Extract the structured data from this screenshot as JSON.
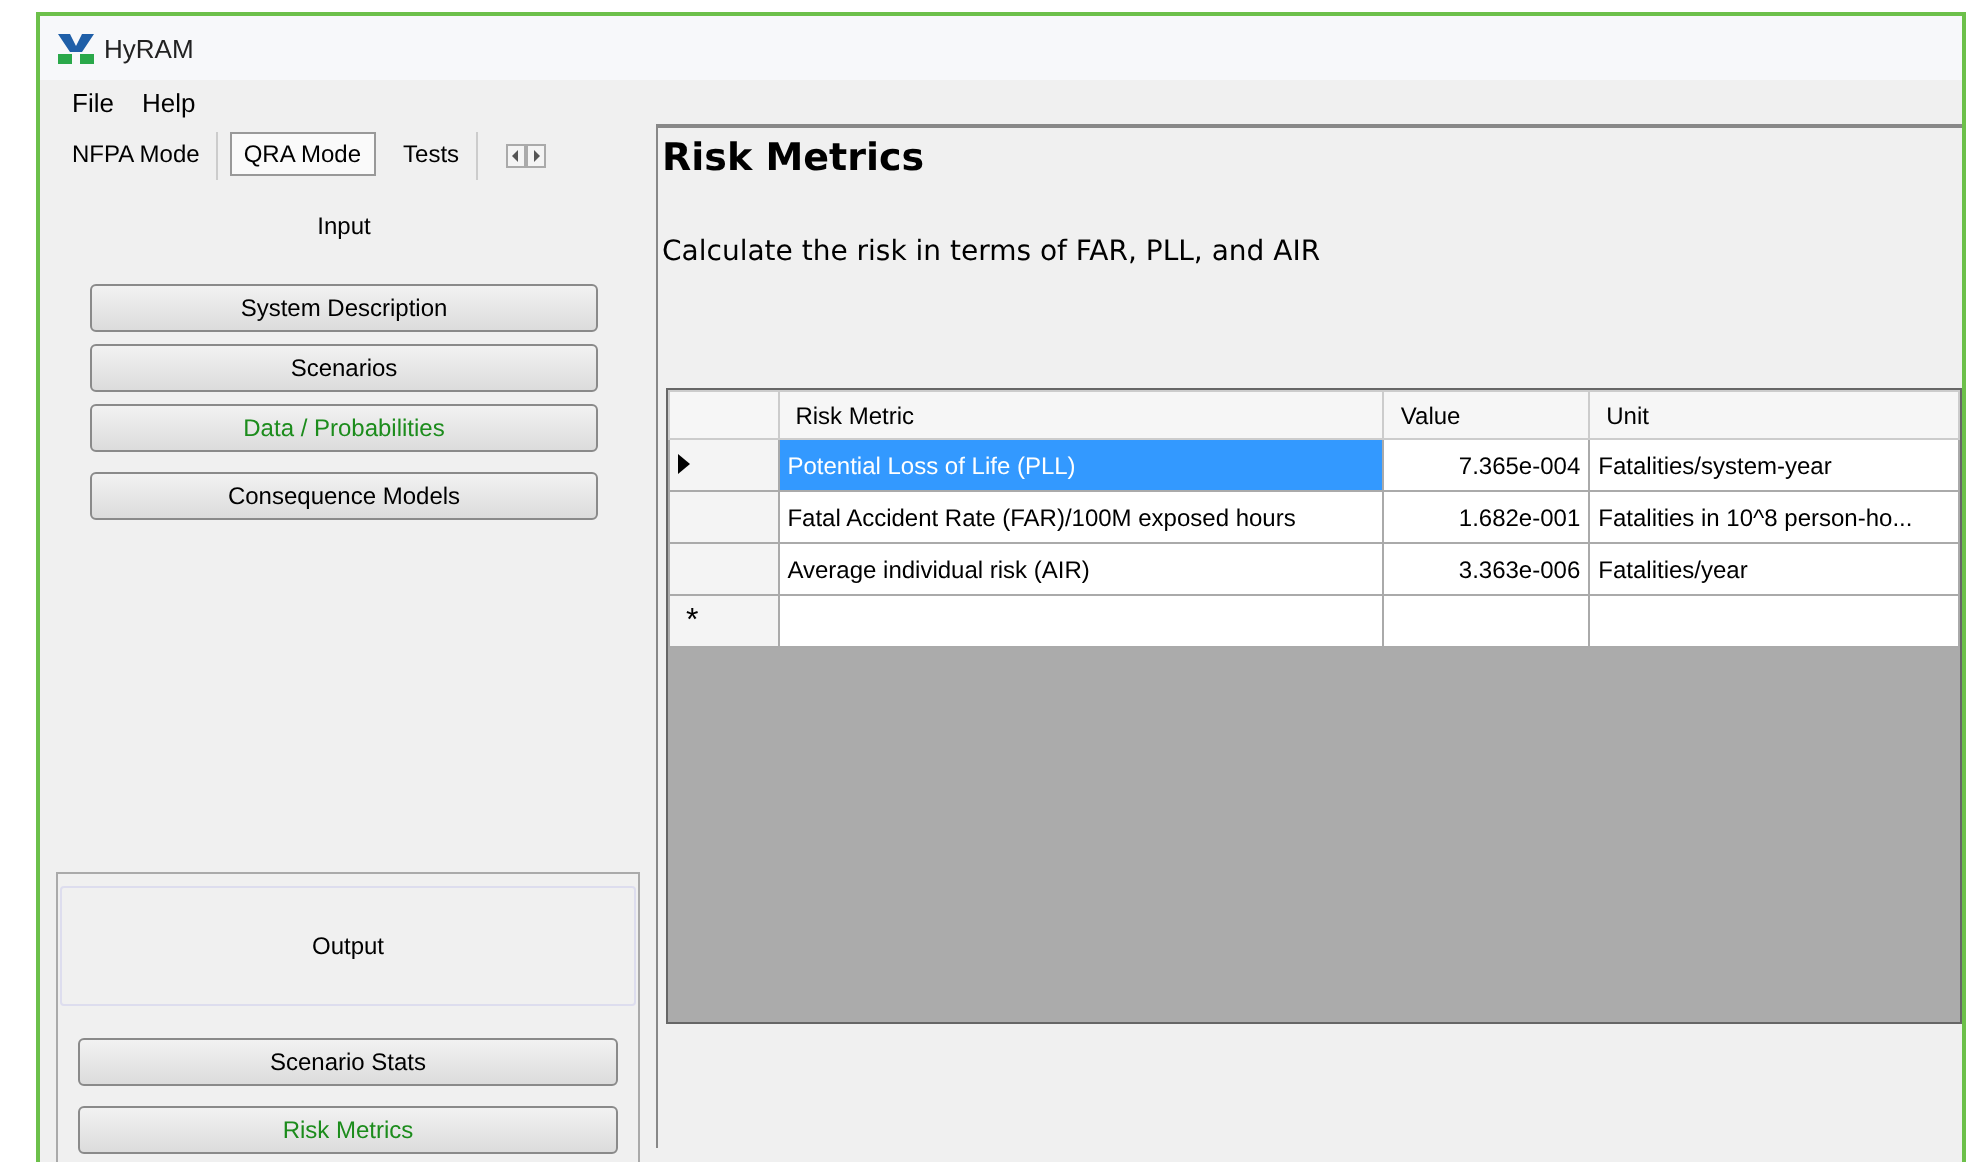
{
  "window": {
    "title": "HyRAM"
  },
  "menu": [
    "File",
    "Help"
  ],
  "tabs": [
    {
      "label": "NFPA Mode",
      "selected": false
    },
    {
      "label": "QRA Mode",
      "selected": true
    },
    {
      "label": "Tests",
      "selected": false
    }
  ],
  "input": {
    "heading": "Input",
    "buttons": [
      {
        "label": "System Description",
        "highlighted": false
      },
      {
        "label": "Scenarios",
        "highlighted": false
      },
      {
        "label": "Data / Probabilities",
        "highlighted": true
      },
      {
        "label": "Consequence Models",
        "highlighted": false
      }
    ]
  },
  "output": {
    "heading": "Output",
    "buttons": [
      {
        "label": "Scenario Stats",
        "highlighted": false
      },
      {
        "label": "Risk Metrics",
        "highlighted": true
      }
    ]
  },
  "content": {
    "title": "Risk Metrics",
    "description": "Calculate the risk in terms of FAR, PLL, and AIR"
  },
  "table": {
    "columns": [
      "Risk Metric",
      "Value",
      "Unit"
    ],
    "rows": [
      {
        "cells": [
          "Potential Loss of Life (PLL)",
          "7.365e-004",
          "Fatalities/system-year"
        ],
        "selected": true,
        "current": true
      },
      {
        "cells": [
          "Fatal Accident Rate (FAR)/100M exposed hours",
          "1.682e-001",
          "Fatalities in 10^8 person-ho..."
        ],
        "selected": false,
        "current": false
      },
      {
        "cells": [
          "Average individual risk (AIR)",
          "3.363e-006",
          "Fatalities/year"
        ],
        "selected": false,
        "current": false
      }
    ],
    "new_row_marker": "*"
  }
}
